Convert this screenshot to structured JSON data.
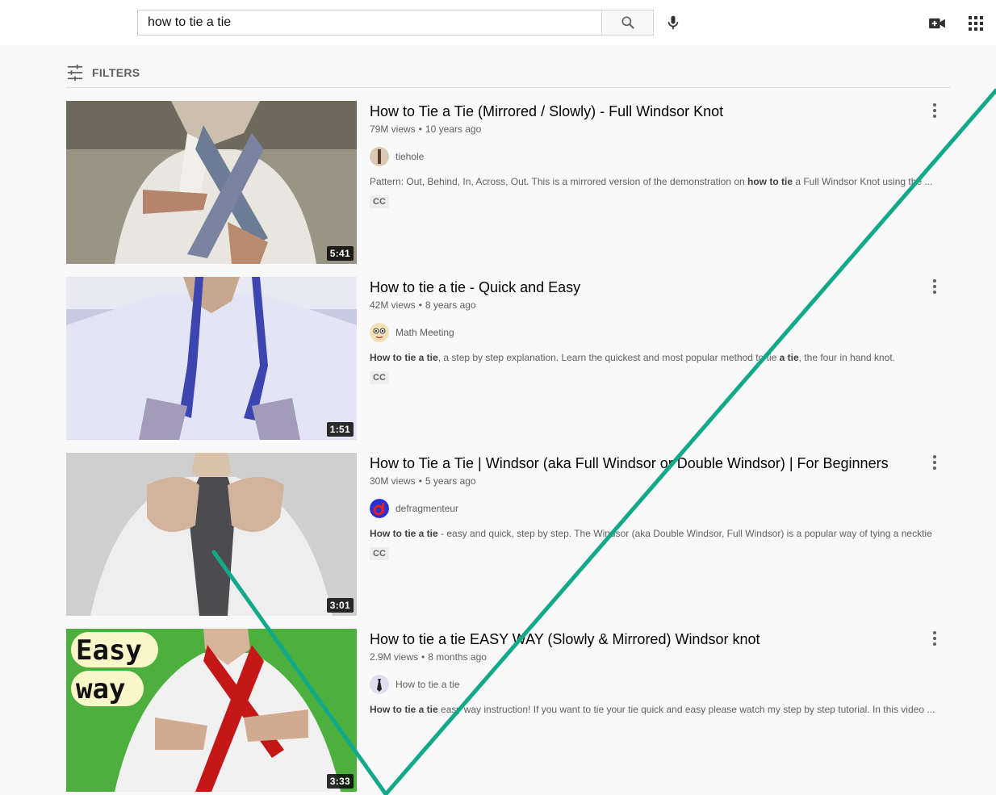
{
  "search": {
    "query": "how to tie a tie"
  },
  "filters": {
    "label": "FILTERS"
  },
  "results": [
    {
      "title": "How to Tie a Tie (Mirrored / Slowly) - Full Windsor Knot",
      "views": "79M views",
      "age": "10 years ago",
      "channel": "tiehole",
      "desc_parts": [
        "Pattern: Out, Behind, In, Across, Out. This is a mirrored version of the demonstration on ",
        "how to tie",
        " a Full Windsor Knot using the ..."
      ],
      "badge": "CC",
      "duration": "5:41"
    },
    {
      "title": "How to tie a tie - Quick and Easy",
      "views": "42M views",
      "age": "8 years ago",
      "channel": "Math Meeting",
      "desc_parts": [
        "How to tie a tie",
        ", a step by step explanation. Learn the quickest and most popular method to tie ",
        "a tie",
        ", the four in hand knot."
      ],
      "badge": "CC",
      "duration": "1:51"
    },
    {
      "title": "How to Tie a Tie | Windsor (aka Full Windsor or Double Windsor) | For Beginners",
      "views": "30M views",
      "age": "5 years ago",
      "channel": "defragmenteur",
      "desc_parts": [
        "How to tie a tie",
        " - easy and quick, step by step. The Windsor (aka Double Windsor, Full Windsor) is a popular way of tying a necktie ..."
      ],
      "badge": "CC",
      "duration": "3:01"
    },
    {
      "title": "How to tie a tie EASY WAY (Slowly & Mirrored) Windsor knot",
      "views": "2.9M views",
      "age": "8 months ago",
      "channel": "How to tie a tie",
      "desc_parts": [
        "How to tie a tie",
        " easy way instruction! If you want to tie your tie quick and easy please watch my step by step tutorial. In this video ..."
      ],
      "duration": "3:33",
      "thumb_text": [
        "Easy",
        "way"
      ]
    }
  ],
  "icons": {
    "search": "search-icon",
    "mic": "microphone-icon",
    "create": "video-camera-plus-icon",
    "apps": "apps-grid-icon",
    "filters": "sliders-icon",
    "more": "more-vertical-icon"
  },
  "colors": {
    "annotation_check": "#12a98a"
  }
}
